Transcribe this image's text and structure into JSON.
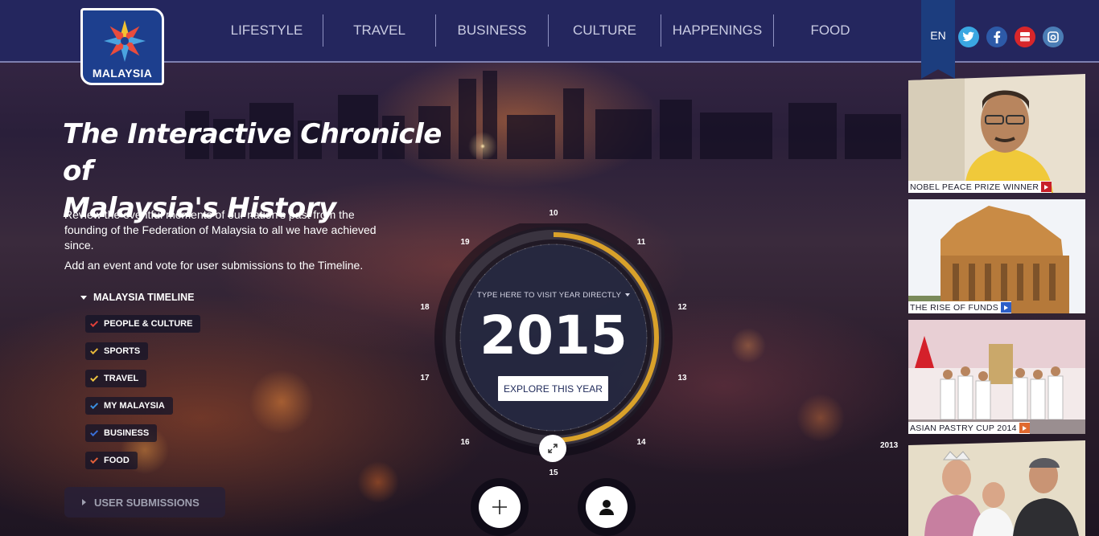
{
  "header": {
    "logo_text": "MALAYSIA",
    "nav": [
      {
        "label": "LIFESTYLE"
      },
      {
        "label": "TRAVEL"
      },
      {
        "label": "BUSINESS"
      },
      {
        "label": "CULTURE"
      },
      {
        "label": "HAPPENINGS"
      },
      {
        "label": "FOOD"
      }
    ],
    "language": "EN",
    "social": [
      {
        "icon": "twitter-icon",
        "color": "#3aa7e2"
      },
      {
        "icon": "facebook-icon",
        "color": "#2d5aa8"
      },
      {
        "icon": "youtube-icon",
        "color": "#d8262a"
      },
      {
        "icon": "instagram-icon",
        "color": "#4b7db5"
      }
    ]
  },
  "hero": {
    "title_line1": "The Interactive Chronicle of",
    "title_line2": "Malaysia's History",
    "description": "Review the eventful moments of our nation's past from the founding of the Federation of Malaysia to all we have achieved since.",
    "description2": "Add an event and vote for user submissions to the Timeline."
  },
  "timeline": {
    "heading": "MALAYSIA TIMELINE",
    "categories": [
      {
        "label": "PEOPLE & CULTURE",
        "color": "#e2403a"
      },
      {
        "label": "SPORTS",
        "color": "#e8b83a"
      },
      {
        "label": "TRAVEL",
        "color": "#f0c640"
      },
      {
        "label": "MY MALAYSIA",
        "color": "#3a8fe0"
      },
      {
        "label": "BUSINESS",
        "color": "#3a6fd8"
      },
      {
        "label": "FOOD",
        "color": "#e4603a"
      }
    ],
    "user_submissions": "USER SUBMISSIONS"
  },
  "dial": {
    "labels": [
      "10",
      "11",
      "12",
      "13",
      "14",
      "15",
      "16",
      "17",
      "18",
      "19"
    ],
    "hint": "TYPE HERE TO VISIT YEAR DIRECTLY",
    "year": "2015",
    "explore_label": "EXPLORE THIS YEAR",
    "progress_fraction": 0.5,
    "accent_color": "#d9a12a",
    "side_year": "2013"
  },
  "cards": [
    {
      "caption": "NOBEL PEACE PRIZE WINNER",
      "arrow_color": "#c8202a"
    },
    {
      "caption": "THE RISE OF FUNDS",
      "arrow_color": "#2d5fc8"
    },
    {
      "caption": "ASIAN PASTRY CUP 2014",
      "arrow_color": "#e06a30"
    },
    {
      "caption": ""
    }
  ]
}
